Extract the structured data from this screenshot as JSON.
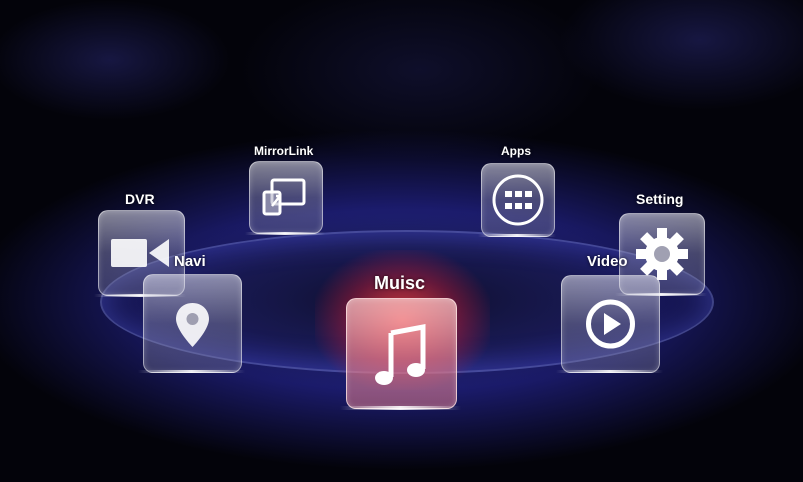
{
  "menu": {
    "mirrorlink": {
      "label": "MirrorLink",
      "icon": "mirrorlink-icon"
    },
    "apps": {
      "label": "Apps",
      "icon": "apps-grid-icon"
    },
    "dvr": {
      "label": "DVR",
      "icon": "video-camera-icon"
    },
    "setting": {
      "label": "Setting",
      "icon": "gear-icon"
    },
    "navi": {
      "label": "Navi",
      "icon": "map-pin-icon"
    },
    "video": {
      "label": "Video",
      "icon": "play-icon"
    },
    "music": {
      "label": "Muisc",
      "icon": "music-note-icon",
      "selected": true
    }
  },
  "colors": {
    "ring_glow": "#4650ff",
    "selected_glow": "#ff4646",
    "label": "#ffffff"
  }
}
